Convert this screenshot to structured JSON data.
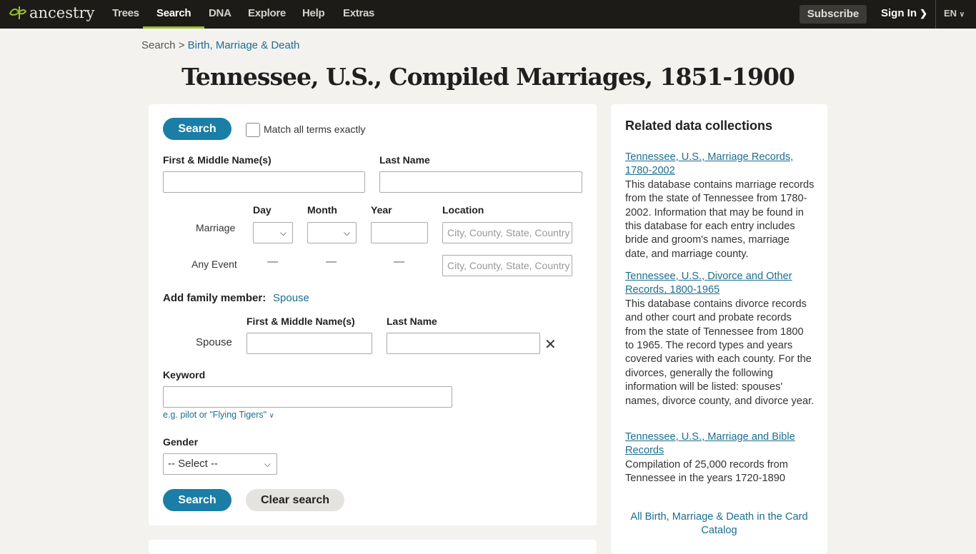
{
  "nav": {
    "logo": "ancestry",
    "items": [
      "Trees",
      "Search",
      "DNA",
      "Explore",
      "Help",
      "Extras"
    ],
    "active": "Search",
    "subscribe": "Subscribe",
    "sign_in": "Sign In",
    "lang": "EN"
  },
  "breadcrumb": {
    "root": "Search",
    "sep": ">",
    "current": "Birth, Marriage & Death"
  },
  "title": "Tennessee, U.S., Compiled Marriages, 1851-1900",
  "form": {
    "search_label": "Search",
    "match_exact": "Match all terms exactly",
    "match_exact_checked": false,
    "first_name_label": "First & Middle Name(s)",
    "last_name_label": "Last Name",
    "day_label": "Day",
    "month_label": "Month",
    "year_label": "Year",
    "location_label": "Location",
    "marriage_label": "Marriage",
    "any_event_label": "Any Event",
    "dash": "—",
    "location_placeholder": "City, County, State, Country",
    "add_family_label": "Add family member:",
    "spouse_link": "Spouse",
    "spouse_label": "Spouse",
    "spouse_first_label": "First & Middle Name(s)",
    "spouse_last_label": "Last Name",
    "keyword_label": "Keyword",
    "keyword_hint": "e.g. pilot or \"Flying Tigers\"",
    "gender_label": "Gender",
    "gender_value": "-- Select --",
    "clear_label": "Clear search"
  },
  "related": {
    "title": "Related data collections",
    "items": [
      {
        "link": "Tennessee, U.S., Marriage Records, 1780-2002",
        "desc": "This database contains marriage records from the state of Tennessee from 1780-2002. Information that may be found in this database for each entry includes bride and groom's names, marriage date, and marriage county."
      },
      {
        "link": "Tennessee, U.S., Divorce and Other Records, 1800-1965",
        "desc": "This database contains divorce records and other court and probate records from the state of Tennessee from 1800 to 1965. The record types and years covered varies with each county. For the divorces, generally the following information will be listed: spouses' names, divorce county, and divorce year."
      },
      {
        "link": "Tennessee, U.S., Marriage and Bible Records",
        "desc": "Compilation of 25,000 records from Tennessee in the years 1720-1890"
      }
    ],
    "catalog_link": "All Birth, Marriage & Death in the Card Catalog"
  },
  "colors": {
    "accent": "#1a7ea6",
    "nav_bg": "#1c1b17",
    "active_underline": "#9cbe30"
  }
}
